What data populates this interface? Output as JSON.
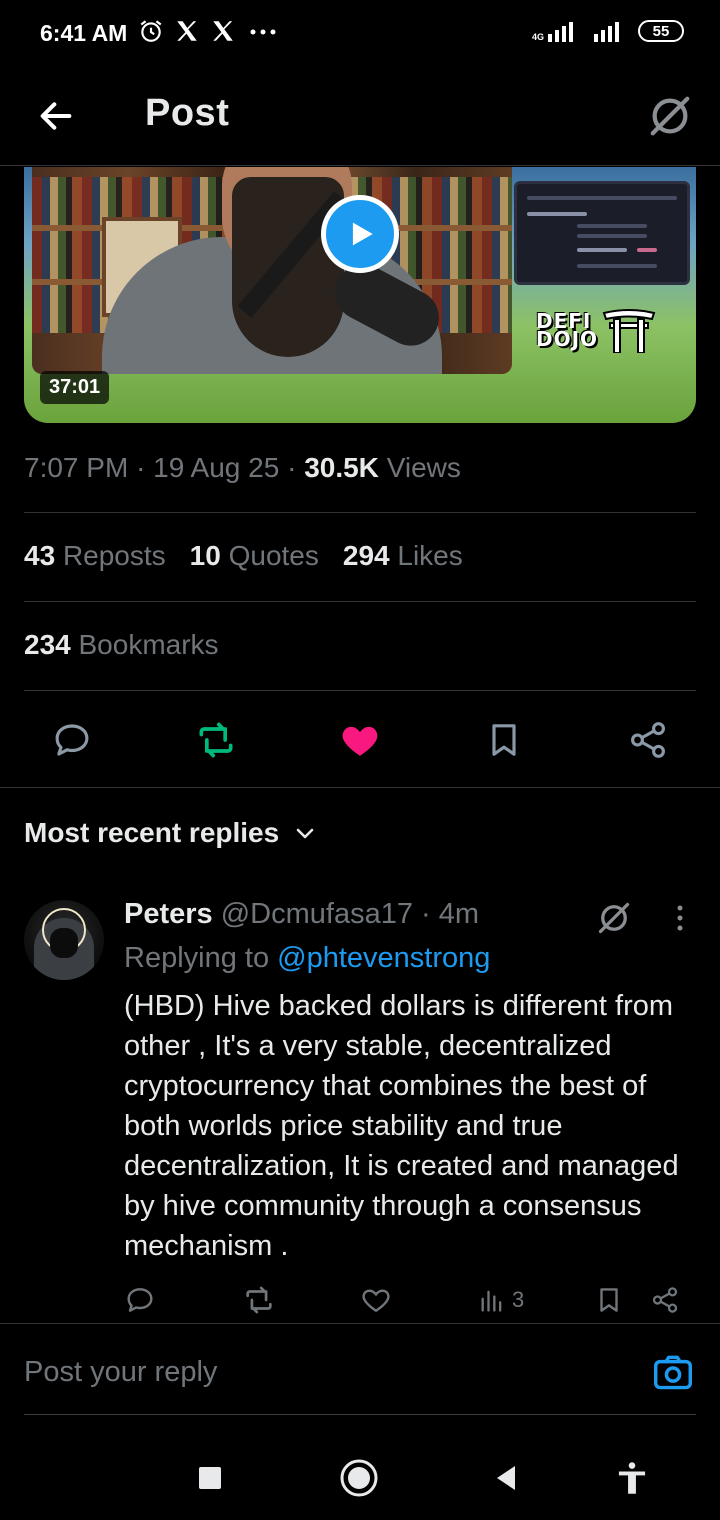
{
  "status_bar": {
    "time": "6:41 AM",
    "network": "4G",
    "battery": "55"
  },
  "header": {
    "title": "Post"
  },
  "media": {
    "duration": "37:01",
    "logo_line1": "DEFI",
    "logo_line2": "DOJO"
  },
  "meta": {
    "time": "7:07 PM",
    "date": "19 Aug 25",
    "views_count": "30.5K",
    "views_label": "Views"
  },
  "stats": {
    "reposts_count": "43",
    "reposts_label": "Reposts",
    "quotes_count": "10",
    "quotes_label": "Quotes",
    "likes_count": "294",
    "likes_label": "Likes",
    "bookmarks_count": "234",
    "bookmarks_label": "Bookmarks"
  },
  "actions": {
    "like_color": "#f91880",
    "repost_color": "#00ba7c"
  },
  "replies": {
    "sort_label": "Most recent replies",
    "items": [
      {
        "name": "Peters",
        "handle": "@Dcmufasa17",
        "time": "4m",
        "replying_prefix": "Replying to",
        "replying_to": "@phtevenstrong",
        "text": "(HBD) Hive backed dollars is different from other , It's a very stable, decentralized cryptocurrency that combines the best of  both worlds price stability and true decentralization, It is created and managed by hive community through a consensus mechanism .",
        "views": "3"
      }
    ]
  },
  "composer": {
    "placeholder": "Post your reply"
  }
}
